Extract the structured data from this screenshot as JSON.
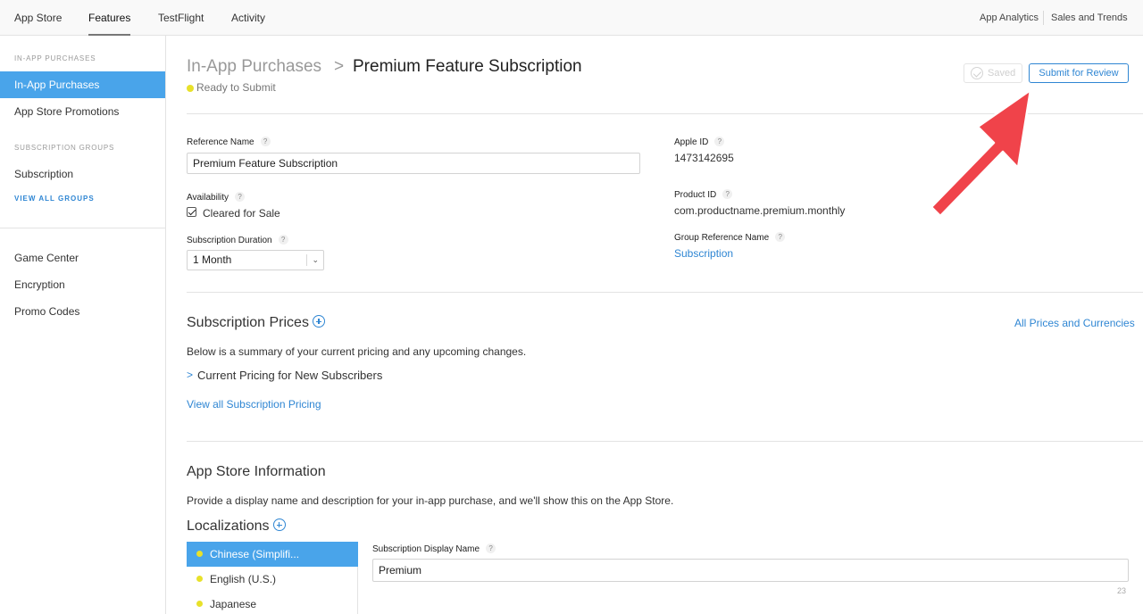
{
  "topnav": {
    "tabs": [
      {
        "label": "App Store"
      },
      {
        "label": "Features"
      },
      {
        "label": "TestFlight"
      },
      {
        "label": "Activity"
      }
    ],
    "active_tab": "Features",
    "right_links": [
      {
        "label": "App Analytics"
      },
      {
        "label": "Sales and Trends"
      }
    ]
  },
  "sidebar": {
    "heading_iap": "IN-APP PURCHASES",
    "items_iap": [
      {
        "label": "In-App Purchases"
      },
      {
        "label": "App Store Promotions"
      }
    ],
    "heading_groups": "SUBSCRIPTION GROUPS",
    "items_groups": [
      {
        "label": "Subscription"
      }
    ],
    "view_all_groups": "VIEW ALL GROUPS",
    "items_other": [
      {
        "label": "Game Center"
      },
      {
        "label": "Encryption"
      },
      {
        "label": "Promo Codes"
      }
    ]
  },
  "header": {
    "parent": "In-App Purchases",
    "separator": ">",
    "current": "Premium Feature Subscription",
    "status": "Ready to Submit",
    "saved_label": "Saved",
    "submit_label": "Submit for Review"
  },
  "form": {
    "reference_name_label": "Reference Name",
    "reference_name_value": "Premium Feature Subscription",
    "availability_label": "Availability",
    "cleared_for_sale": "Cleared for Sale",
    "duration_label": "Subscription Duration",
    "duration_value": "1 Month",
    "apple_id_label": "Apple ID",
    "apple_id_value": "1473142695",
    "product_id_label": "Product ID",
    "product_id_value": "com.productname.premium.monthly",
    "group_ref_label": "Group Reference Name",
    "group_ref_value": "Subscription",
    "help": "?"
  },
  "prices": {
    "title": "Subscription Prices",
    "all_prices_link": "All Prices and Currencies",
    "summary": "Below is a summary of your current pricing and any upcoming changes.",
    "disclosure_icon": ">",
    "current_pricing": "Current Pricing for New Subscribers",
    "view_all_link": "View all Subscription Pricing"
  },
  "app_store_info": {
    "title": "App Store Information",
    "description": "Provide a display name and description for your in-app purchase, and we'll show this on the App Store.",
    "localizations_title": "Localizations",
    "localizations": [
      {
        "label": "Chinese (Simplifi..."
      },
      {
        "label": "English (U.S.)"
      },
      {
        "label": "Japanese"
      }
    ],
    "display_name_label": "Subscription Display Name",
    "display_name_value": "Premium",
    "char_count": "23"
  },
  "colors": {
    "accent": "#2f86d3",
    "active_bg": "#49a4ea",
    "status_yellow": "#e8e12a",
    "arrow_red": "#f0434a"
  }
}
